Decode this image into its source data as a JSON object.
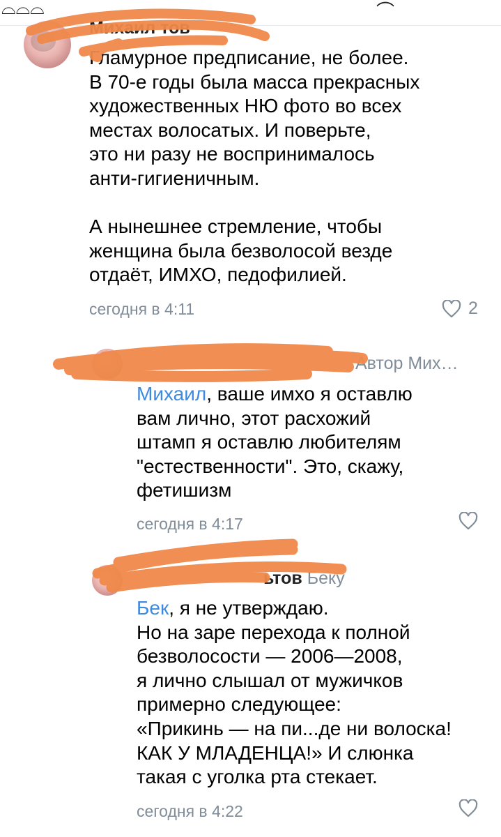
{
  "topbar": {
    "fragment_left": "⌓⌓⌓",
    "fragment_right": "⌒"
  },
  "comments": [
    {
      "author_visible": "Михаил тов",
      "reply_to": "",
      "mention": "",
      "text": "Гламурное предписание, не более.\nВ 70-е годы была масса прекрасных\nхудожественных НЮ фото во всех\nместах волосатых. И поверьте,\nэто ни разу не воспринималось\nанти-гигиеничным.\n\nА нынешнее стремление, чтобы\nженщина была безволосой везде\nотдаёт, ИМХО, педофилией.",
      "time": "сегодня в 4:11",
      "likes": "2"
    },
    {
      "author_visible": "",
      "reply_to": "Автор Мих…",
      "mention": "Михаил",
      "text": ", ваше имхо я оставлю\nвам лично, этот расхожий\nштамп я оставлю любителям\n\"естественности\". Это, скажу,\nфетишизм",
      "time": "сегодня в 4:17",
      "likes": ""
    },
    {
      "author_visible": "ьтов",
      "reply_to": "Беку",
      "mention": "Бек",
      "text": ", я не утверждаю.\nНо на заре перехода к полной\nбезволосости — 2006—2008,\nя лично слышал от мужичков\nпримерно следующее:\n«Прикинь — на пи...де ни волоска!\nКАК У МЛАДЕНЦА!» И слюнка\nтакая с уголка рта стекает.",
      "time": "сегодня в 4:22",
      "likes": ""
    }
  ],
  "colors": {
    "mention": "#3f8ae0",
    "meta": "#818c99",
    "scribble": "#f0894a"
  }
}
